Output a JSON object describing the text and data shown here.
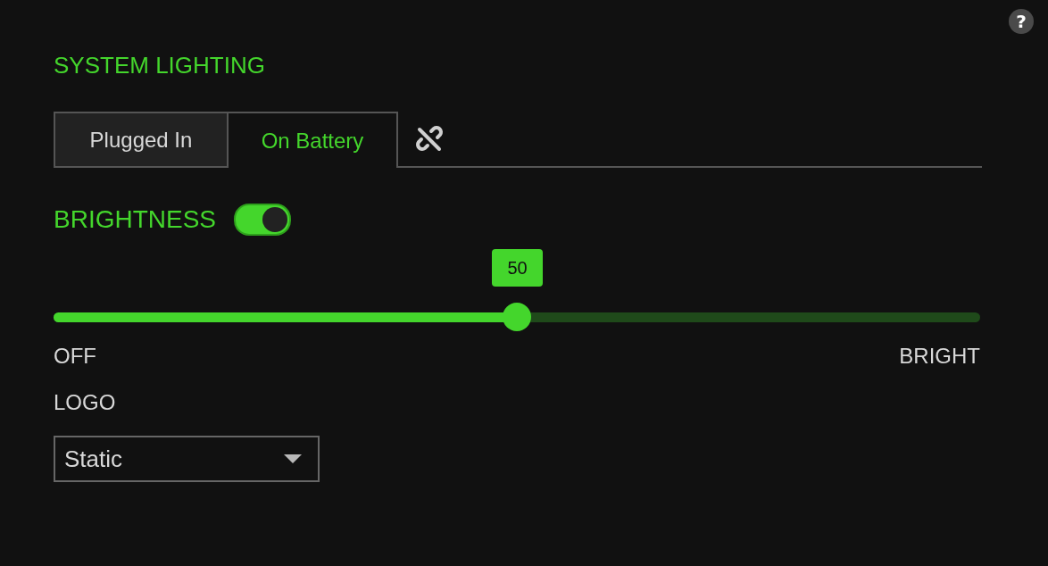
{
  "help_button": {
    "label": "?"
  },
  "title": "SYSTEM LIGHTING",
  "tabs": [
    {
      "label": "Plugged In",
      "selected": false
    },
    {
      "label": "On Battery",
      "selected": true
    }
  ],
  "link_toggle": {
    "linked": false
  },
  "brightness": {
    "label": "BRIGHTNESS",
    "on": true,
    "level": 0.5,
    "reading": "50",
    "min_label": "OFF",
    "max_label": "BRIGHT"
  },
  "logo": {
    "label": "LOGO",
    "value": "Static"
  }
}
